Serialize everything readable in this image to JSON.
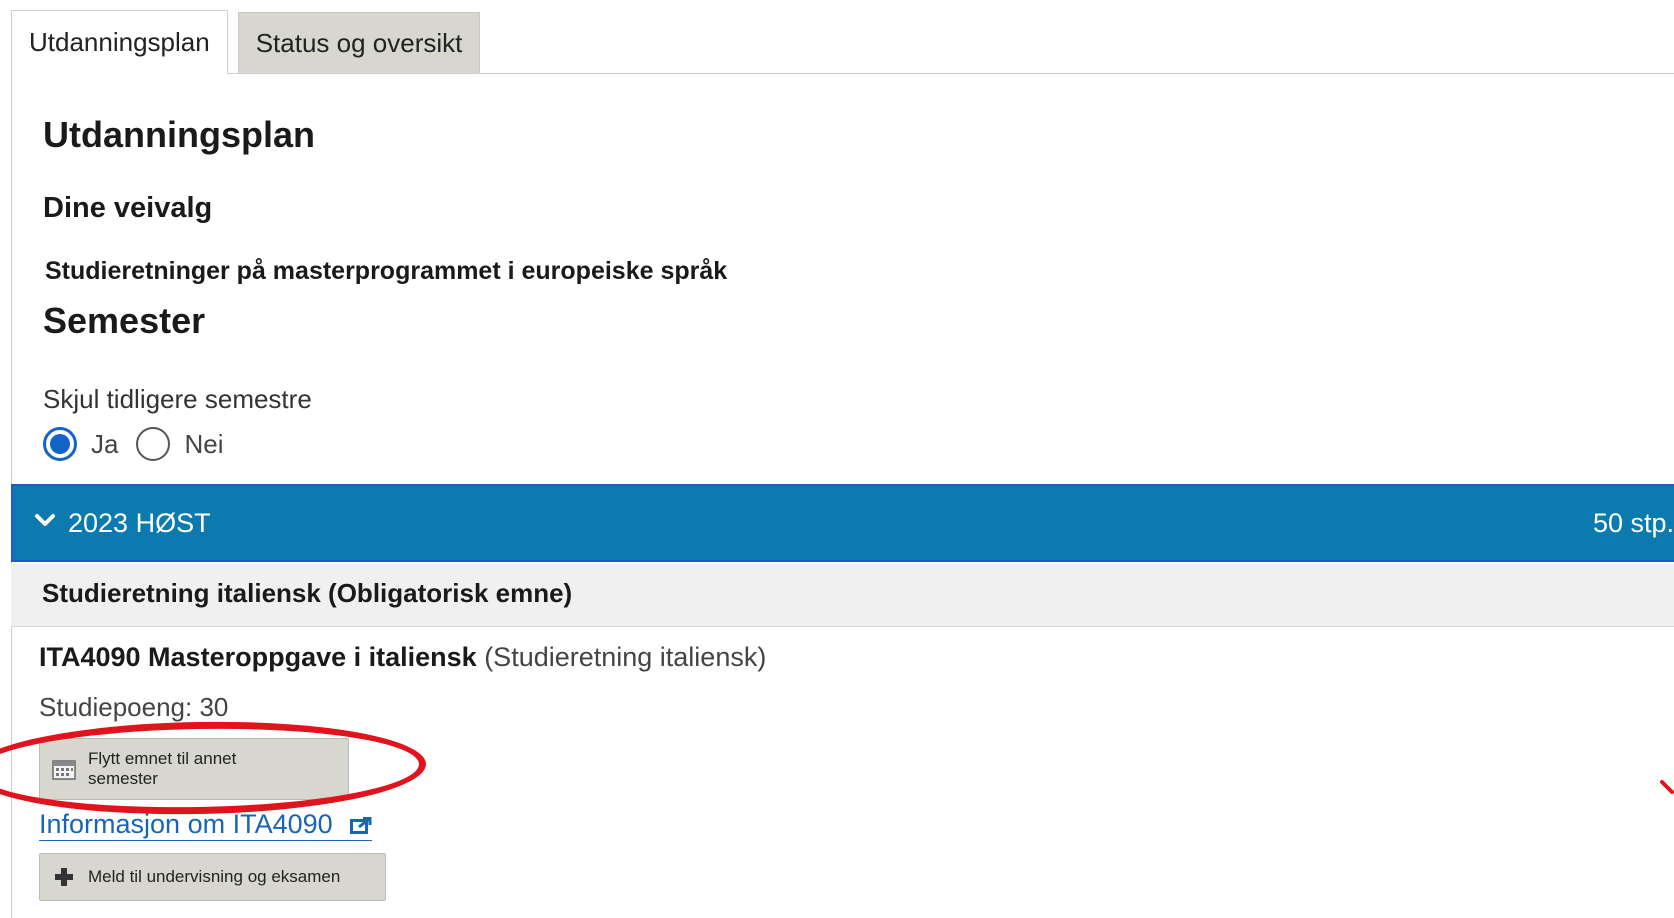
{
  "tabs": [
    {
      "label": "Utdanningsplan",
      "active": true
    },
    {
      "label": "Status og oversikt",
      "active": false
    }
  ],
  "page": {
    "title": "Utdanningsplan",
    "choices_heading": "Dine veivalg",
    "program_heading": "Studieretninger på masterprogrammet i europeiske språk",
    "semester_heading": "Semester"
  },
  "hide_previous": {
    "label": "Skjul tidligere semestre",
    "options": [
      {
        "label": "Ja",
        "checked": true
      },
      {
        "label": "Nei",
        "checked": false
      }
    ]
  },
  "semester": {
    "title": "2023 HØST",
    "credits": "50 stp.",
    "bar_color": "#0a7aaf"
  },
  "section": {
    "heading": "Studieretning italiensk (Obligatorisk emne)"
  },
  "course": {
    "code_title": "ITA4090 Masteroppgave i italiensk",
    "subtitle": "(Studieretning italiensk)",
    "credits": "Studiepoeng: 30",
    "move_button": "Flytt emnet til annet semester",
    "info_link": "Informasjon om ITA4090",
    "enroll_button": "Meld til undervisning og eksamen"
  },
  "annotation": {
    "color": "#e1141d"
  },
  "icons": {
    "semester_toggle": "chevron-down-icon",
    "move": "calendar-icon",
    "external": "external-link-icon",
    "enroll": "plus-icon"
  }
}
